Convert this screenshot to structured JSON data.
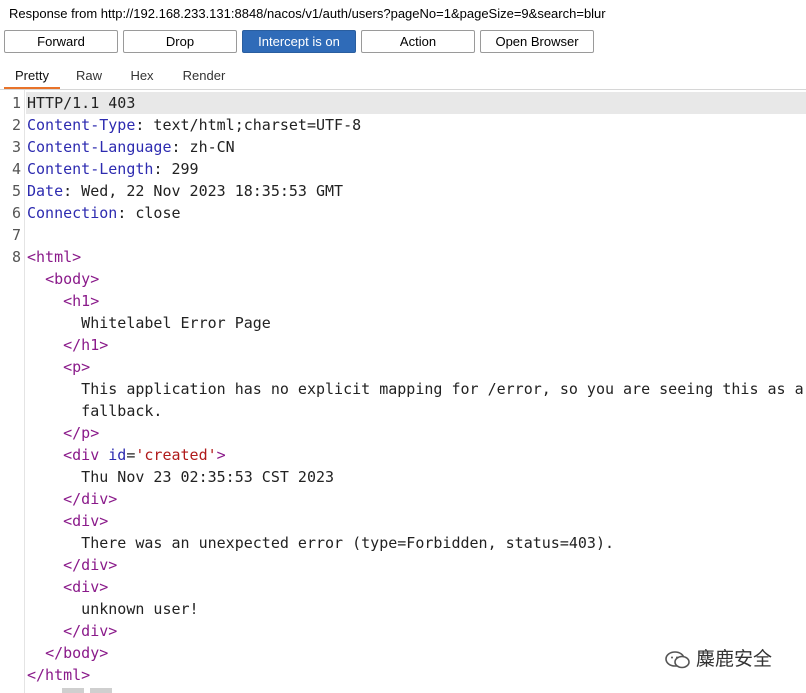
{
  "window": {
    "title": "Response from http://192.168.233.131:8848/nacos/v1/auth/users?pageNo=1&pageSize=9&search=blur"
  },
  "toolbar": {
    "forward_label": "Forward",
    "drop_label": "Drop",
    "intercept_label": "Intercept is on",
    "action_label": "Action",
    "open_browser_label": "Open Browser"
  },
  "tabs": [
    {
      "label": "Pretty",
      "active": true
    },
    {
      "label": "Raw",
      "active": false
    },
    {
      "label": "Hex",
      "active": false
    },
    {
      "label": "Render",
      "active": false
    }
  ],
  "editor": {
    "lines": [
      {
        "num": "1",
        "segments": [
          {
            "t": "HTTP/1.1 403",
            "c": "text"
          }
        ]
      },
      {
        "num": "2",
        "segments": [
          {
            "t": "Content-Type",
            "c": "key"
          },
          {
            "t": ": text/html;charset=UTF-8",
            "c": "text"
          }
        ]
      },
      {
        "num": "3",
        "segments": [
          {
            "t": "Content-Language",
            "c": "key"
          },
          {
            "t": ": zh-CN",
            "c": "text"
          }
        ]
      },
      {
        "num": "4",
        "segments": [
          {
            "t": "Content-Length",
            "c": "key"
          },
          {
            "t": ": 299",
            "c": "text"
          }
        ]
      },
      {
        "num": "5",
        "segments": [
          {
            "t": "Date",
            "c": "key"
          },
          {
            "t": ": Wed, 22 Nov 2023 18:35:53 GMT",
            "c": "text"
          }
        ]
      },
      {
        "num": "6",
        "segments": [
          {
            "t": "Connection",
            "c": "key"
          },
          {
            "t": ": close",
            "c": "text"
          }
        ]
      },
      {
        "num": "7",
        "segments": []
      },
      {
        "num": "8",
        "segments": [
          {
            "t": "<html>",
            "c": "tag"
          }
        ]
      },
      {
        "num": "",
        "segments": [
          {
            "t": "  ",
            "c": "text"
          },
          {
            "t": "<body>",
            "c": "tag"
          }
        ]
      },
      {
        "num": "",
        "segments": [
          {
            "t": "    ",
            "c": "text"
          },
          {
            "t": "<h1>",
            "c": "tag"
          }
        ]
      },
      {
        "num": "",
        "segments": [
          {
            "t": "      Whitelabel Error Page",
            "c": "text"
          }
        ]
      },
      {
        "num": "",
        "segments": [
          {
            "t": "    ",
            "c": "text"
          },
          {
            "t": "</h1>",
            "c": "tag"
          }
        ]
      },
      {
        "num": "",
        "segments": [
          {
            "t": "    ",
            "c": "text"
          },
          {
            "t": "<p>",
            "c": "tag"
          }
        ]
      },
      {
        "num": "",
        "segments": [
          {
            "t": "      This application has no explicit mapping for /error, so you are seeing this as a",
            "c": "text"
          }
        ]
      },
      {
        "num": "",
        "segments": [
          {
            "t": "      fallback.",
            "c": "text"
          }
        ]
      },
      {
        "num": "",
        "segments": [
          {
            "t": "    ",
            "c": "text"
          },
          {
            "t": "</p>",
            "c": "tag"
          }
        ]
      },
      {
        "num": "",
        "segments": [
          {
            "t": "    ",
            "c": "text"
          },
          {
            "t": "<div ",
            "c": "tag"
          },
          {
            "t": "id",
            "c": "attr"
          },
          {
            "t": "=",
            "c": "text"
          },
          {
            "t": "'created'",
            "c": "val"
          },
          {
            "t": ">",
            "c": "tag"
          }
        ]
      },
      {
        "num": "",
        "segments": [
          {
            "t": "      Thu Nov 23 02:35:53 CST 2023",
            "c": "text"
          }
        ]
      },
      {
        "num": "",
        "segments": [
          {
            "t": "    ",
            "c": "text"
          },
          {
            "t": "</div>",
            "c": "tag"
          }
        ]
      },
      {
        "num": "",
        "segments": [
          {
            "t": "    ",
            "c": "text"
          },
          {
            "t": "<div>",
            "c": "tag"
          }
        ]
      },
      {
        "num": "",
        "segments": [
          {
            "t": "      There was an unexpected error (type=Forbidden, status=403).",
            "c": "text"
          }
        ]
      },
      {
        "num": "",
        "segments": [
          {
            "t": "    ",
            "c": "text"
          },
          {
            "t": "</div>",
            "c": "tag"
          }
        ]
      },
      {
        "num": "",
        "segments": [
          {
            "t": "    ",
            "c": "text"
          },
          {
            "t": "<div>",
            "c": "tag"
          }
        ]
      },
      {
        "num": "",
        "segments": [
          {
            "t": "      unknown user!",
            "c": "text"
          }
        ]
      },
      {
        "num": "",
        "segments": [
          {
            "t": "    ",
            "c": "text"
          },
          {
            "t": "</div>",
            "c": "tag"
          }
        ]
      },
      {
        "num": "",
        "segments": [
          {
            "t": "  ",
            "c": "text"
          },
          {
            "t": "</body>",
            "c": "tag"
          }
        ]
      },
      {
        "num": "",
        "segments": [
          {
            "t": "</html>",
            "c": "tag"
          }
        ]
      }
    ]
  },
  "watermark": {
    "text": "麋鹿安全",
    "icon": "wechat-icon"
  },
  "colors": {
    "accent_button": "#2f6bb8",
    "active_tab_underline": "#e8732a",
    "header_key": "#2d2bb0",
    "html_tag": "#8a1a8a",
    "attr_value": "#b01a1a"
  }
}
